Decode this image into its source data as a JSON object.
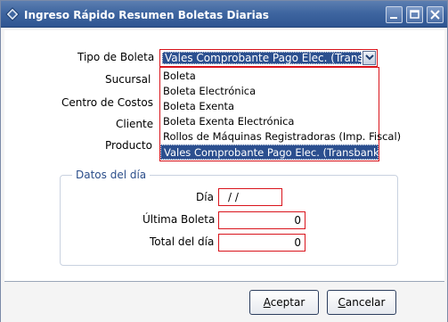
{
  "window": {
    "title": "Ingreso Rápido Resumen Boletas Diarias"
  },
  "form": {
    "tipo_boleta_label": "Tipo de Boleta",
    "tipo_boleta_value": "Vales Comprobante Pago Elec. (Transbar",
    "sucursal_label": "Sucursal",
    "centro_costos_label": "Centro de Costos",
    "cliente_label": "Cliente",
    "producto_label": "Producto"
  },
  "dropdown": {
    "options": [
      "Boleta",
      "Boleta Electrónica",
      "Boleta Exenta",
      "Boleta Exenta Electrónica",
      "Rollos de Máquinas Registradoras (Imp. Fiscal)",
      "Vales Comprobante Pago Elec. (Transbank)"
    ],
    "selected_index": 5
  },
  "datos_dia": {
    "group_title": "Datos del día",
    "dia_label": "Día",
    "dia_value": " /  /",
    "ultima_boleta_label": "Última Boleta",
    "ultima_boleta_value": "0",
    "total_dia_label": "Total del día",
    "total_dia_value": "0"
  },
  "footer": {
    "aceptar_first": "A",
    "aceptar_rest": "ceptar",
    "cancelar_first": "C",
    "cancelar_rest": "ancelar"
  },
  "colors": {
    "titlebar": "#3f66a0",
    "selection": "#2b4f8f",
    "required_border": "#d9141c",
    "group_title": "#2a4d8a"
  }
}
